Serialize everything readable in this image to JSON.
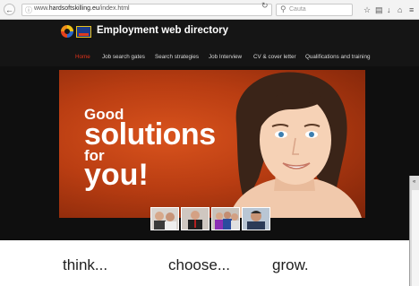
{
  "browser": {
    "url_prefix": "www.",
    "url_domain": "hardsoftskilling.eu",
    "url_path": "/index.html",
    "search_placeholder": "Cauta"
  },
  "site": {
    "title": "Employment web directory",
    "nav": [
      {
        "label": "Home",
        "active": true
      },
      {
        "label": "Job search gates",
        "active": false
      },
      {
        "label": "Search strategies",
        "active": false
      },
      {
        "label": "Job Interview",
        "active": false
      },
      {
        "label": "CV & cover letter",
        "active": false
      },
      {
        "label": "Qualifications and training",
        "active": false
      }
    ]
  },
  "hero": {
    "line1": "Good",
    "line2": "solutions",
    "line3": "for",
    "line4": "you!",
    "accent_color": "#c1441a"
  },
  "taglines": [
    "think...",
    "choose...",
    "grow."
  ],
  "icons": {
    "back": "back-arrow-icon",
    "info": "info-icon",
    "reload": "reload-icon",
    "search": "search-icon",
    "bookmark": "star-icon",
    "reading": "clipboard-icon",
    "download": "download-arrow-icon",
    "home": "home-icon",
    "menu": "hamburger-menu-icon"
  }
}
